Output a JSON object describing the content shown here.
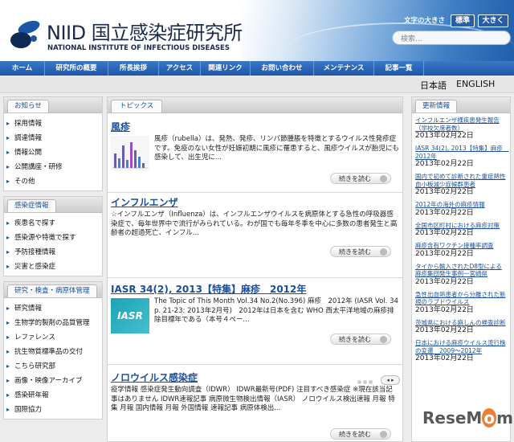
{
  "header": {
    "logo_title": "NIID 国立感染症研究所",
    "logo_subtitle": "NATIONAL INSTITUTE OF INFECTIOUS DISEASES",
    "font_size_label": "文字の大きさ",
    "font_standard": "標準",
    "font_large": "大きく",
    "search_placeholder": "検索..."
  },
  "nav": {
    "items": [
      "ホーム",
      "研究所の概要",
      "所長挨拶",
      "アクセス",
      "関連リンク",
      "お問い合わせ",
      "メンテナンス",
      "記事一覧"
    ]
  },
  "lang": {
    "ja": "日本語",
    "en": "ENGLISH"
  },
  "left": {
    "notice": {
      "title": "お知らせ",
      "items": [
        "採用情報",
        "調達情報",
        "情報公開",
        "公開講座・研修",
        "その他"
      ]
    },
    "disease": {
      "title": "感染症情報",
      "items": [
        "疾患名で探す",
        "感染源や特徴で探す",
        "予防接種情報",
        "災害と感染症"
      ]
    },
    "research": {
      "title": "研究・検査・病原体管理",
      "items": [
        "研究情報",
        "生物学的製剤の品質管理",
        "レファレンス",
        "抗生物質標準品の交付",
        "こちら研究部",
        "画像・映像アーカイブ",
        "感染研年報",
        "国際協力"
      ]
    }
  },
  "topics": {
    "title": "トピックス",
    "more_label": "続きを読む",
    "items": [
      {
        "title": "風疹",
        "body": "風疹（rubella）は、発熱、発疹、リンパ節腫脹を特徴とするウイルス性発疹症です。免疫のない女性が妊娠初期に風疹に罹患すると、風疹ウイルスが胎児にも感染して、出生児に..."
      },
      {
        "title": "インフルエンザ",
        "body": "☆インフルエンザ（Influenza）は、インフルエンザウイルスを病原体とする急性の呼吸器感染症で、毎年世界中で流行がみられている。わが国でも毎年冬季を中心に多数の患者発生と高齢者の超過死亡、インフル..."
      },
      {
        "title": "IASR 34(2), 2013【特集】麻疹　2012年",
        "body": "The Topic of This Month Vol.34 No.2(No.396) 麻疹　2012年 (IASR Vol. 34 p. 21-23: 2013年2月号)　2012年は日本を含む WHO 西太平洋地域の麻疹排除目標年である（本号４ペー..."
      },
      {
        "title": "ノロウイルス感染症",
        "body": "疫学情報 感染症発生動向調査（IDWR） IDWR最新号(PDF) 注目すべき感染症 ※現在該当記事はありません IDWR速報記事 病原微生物検出情報（IASR） ノロウイルス検出速報 月報 特集 月報 国内情報 月報 外国情報 速報記事 病原体検出..."
      }
    ],
    "iasr_thumb_text": "IASR",
    "pager": "◂ ▸"
  },
  "updates": {
    "title": "更新情報",
    "items": [
      {
        "title": "インフルエンザ様疾患発生報告（学校欠席者数）",
        "date": "2013年02月22日"
      },
      {
        "title": "IASR 34(2), 2013【特集】麻疹　2012年",
        "date": "2013年02月22日"
      },
      {
        "title": "国内で初めて診断された重症熱性血小板減少症候群患者",
        "date": "2013年02月22日"
      },
      {
        "title": "2012年の海外の麻疹情報",
        "date": "2013年02月22日"
      },
      {
        "title": "全国市区町村における麻疹対策",
        "date": "2013年02月22日"
      },
      {
        "title": "麻疹含有ワクチン接種率調査",
        "date": "2013年02月22日"
      },
      {
        "title": "タイから輸入されたD8型による麻疹集団発生事例一宮崎県",
        "date": "2013年02月22日"
      },
      {
        "title": "急性出血熱患者から分離された新規のラブドウイルス",
        "date": "2013年02月22日"
      },
      {
        "title": "茨城県における麻しんの検査診断",
        "date": "2013年02月22日"
      },
      {
        "title": "日本における麻疹ウイルス流行株の変遷　2009〜2012年",
        "date": "2013年02月22日"
      }
    ]
  },
  "watermark": {
    "part1": "ReseM",
    "part2": "o",
    "part3": "m"
  },
  "colors": {
    "nav": "#1d56a6",
    "link": "#1a4f9c",
    "bg": "#ececec"
  }
}
